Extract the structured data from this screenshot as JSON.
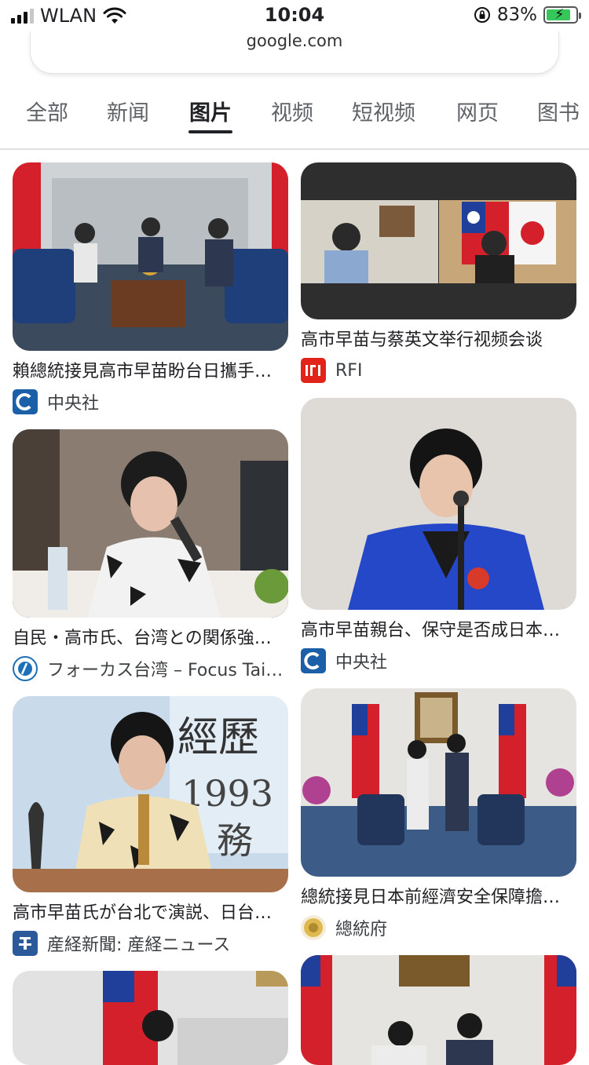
{
  "status_bar": {
    "carrier": "WLAN",
    "time": "10:04",
    "battery": "83%"
  },
  "browser": {
    "url": "google.com"
  },
  "tabs": [
    {
      "label": "全部"
    },
    {
      "label": "新闻"
    },
    {
      "label": "图片",
      "active": true
    },
    {
      "label": "视频"
    },
    {
      "label": "短视频"
    },
    {
      "label": "网页"
    },
    {
      "label": "图书"
    }
  ],
  "results": [
    {
      "caption": "賴總統接見高市早苗盼台日攜手深化交流",
      "source": "中央社",
      "icon": "cna-logo-icon",
      "color": "#1a5fa8"
    },
    {
      "caption": "高市早苗与蔡英文举行视频会谈",
      "source": "RFI",
      "icon": "rfi-logo-icon",
      "color": "#e2231a"
    },
    {
      "caption": "自民・高市氏、台湾との関係強化を訴え",
      "source": "フォーカス台湾 – Focus Taiwan",
      "icon": "focus-taiwan-logo-icon",
      "color": "#1d6fb8"
    },
    {
      "caption": "高市早苗親台、保守是否成日本首相",
      "source": "中央社",
      "icon": "cna-logo-icon",
      "color": "#1a5fa8"
    },
    {
      "caption": "高市早苗氏が台北で演説、日台関係",
      "source": "産経新聞: 産経ニュース",
      "icon": "sankei-logo-icon",
      "color": "#2a5a9a"
    },
    {
      "caption": "總統接見日本前經濟安全保障擔當大臣",
      "source": "總統府",
      "icon": "presidential-office-logo-icon",
      "color": "#b08a2e"
    }
  ]
}
